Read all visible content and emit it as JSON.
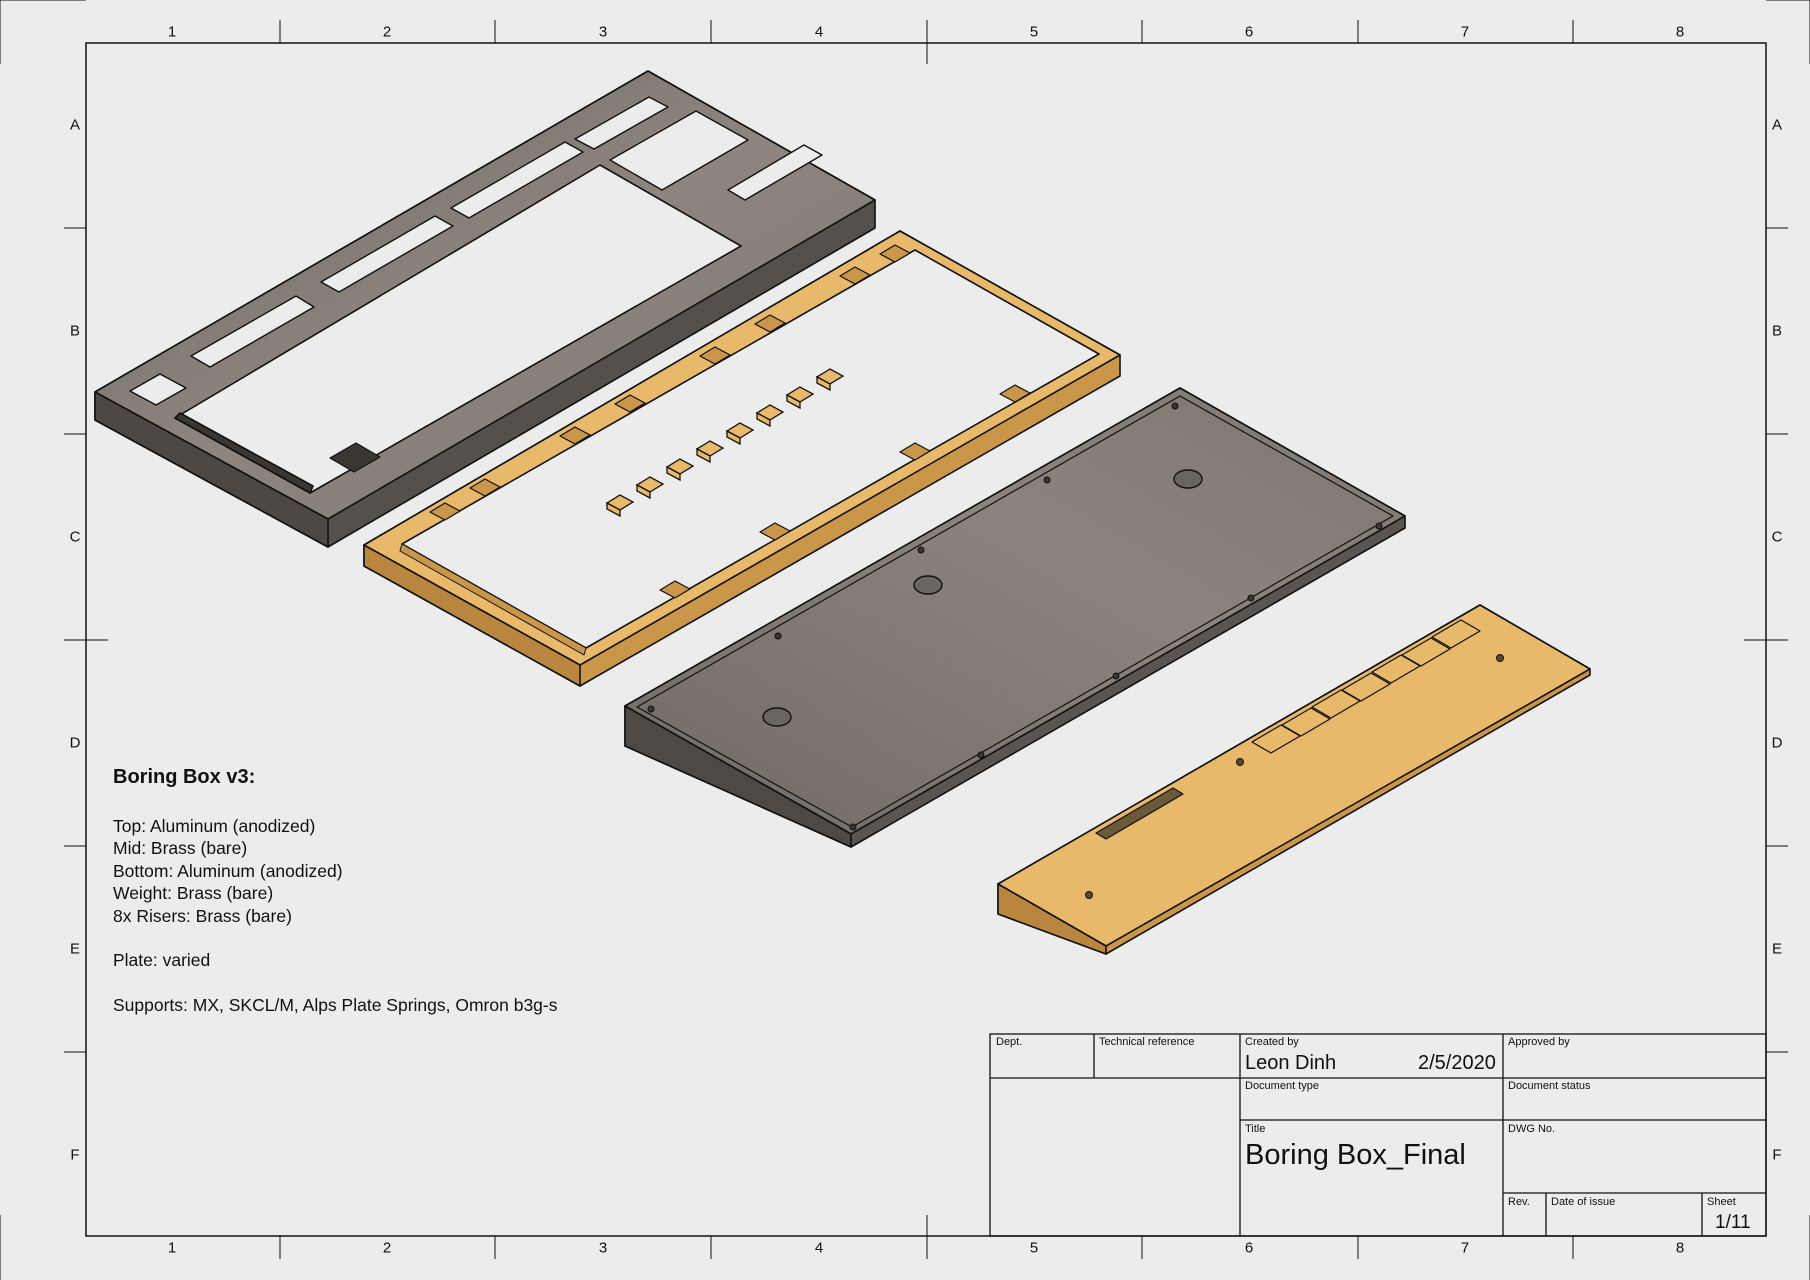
{
  "sheet": {
    "col_labels": [
      "1",
      "2",
      "3",
      "4",
      "5",
      "6",
      "7",
      "8"
    ],
    "row_labels": [
      "A",
      "B",
      "C",
      "D",
      "E",
      "F"
    ]
  },
  "notes": {
    "heading": "Boring Box v3:",
    "materials": [
      "Top: Aluminum (anodized)",
      "Mid: Brass (bare)",
      "Bottom: Aluminum (anodized)",
      "Weight: Brass (bare)",
      "8x Risers: Brass (bare)"
    ],
    "plate": "Plate: varied",
    "supports": "Supports: MX, SKCL/M, Alps Plate Springs, Omron b3g-s"
  },
  "title_block": {
    "dept_label": "Dept.",
    "tech_ref_label": "Technical reference",
    "created_by_label": "Created by",
    "created_by": "Leon Dinh",
    "created_date": "2/5/2020",
    "approved_by_label": "Approved by",
    "doc_type_label": "Document type",
    "doc_status_label": "Document status",
    "title_label": "Title",
    "title": "Boring Box_Final",
    "dwg_no_label": "DWG No.",
    "rev_label": "Rev.",
    "date_issue_label": "Date of issue",
    "sheet_label": "Sheet",
    "sheet": "1/11"
  },
  "colors": {
    "aluminum": "#8a837c",
    "aluminum_dark": "#5f5a55",
    "brass": "#e8b96b",
    "brass_dark": "#c9964a",
    "line": "#111111",
    "paper": "#ececec"
  }
}
